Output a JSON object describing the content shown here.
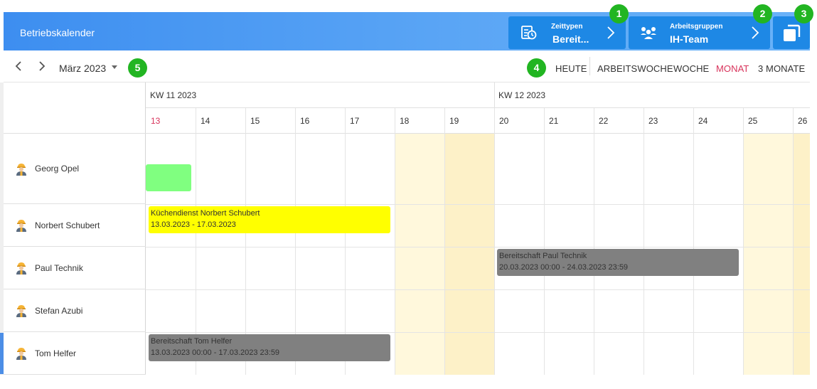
{
  "header": {
    "title": "Betriebskalender",
    "zeittypen": {
      "label": "Zeittypen",
      "value": "Bereit..."
    },
    "arbeitsgruppen": {
      "label": "Arbeitsgruppen",
      "value": "IH-Team"
    }
  },
  "badges": [
    "1",
    "2",
    "3",
    "4",
    "5"
  ],
  "toolbar": {
    "month": "März 2023",
    "views": {
      "heute": "HEUTE",
      "arbeitswoche": "ARBEITSWOCHE",
      "woche": "WOCHE",
      "monat": "MONAT",
      "drei_monate": "3 MONATE"
    },
    "active_view": "monat"
  },
  "calendar": {
    "weeks": [
      "KW 11 2023",
      "KW 12 2023"
    ],
    "days": [
      "13",
      "14",
      "15",
      "16",
      "17",
      "18",
      "19",
      "20",
      "21",
      "22",
      "23",
      "24",
      "25",
      "26"
    ],
    "today": "13"
  },
  "resources": [
    {
      "name": "Georg Opel"
    },
    {
      "name": "Norbert Schubert"
    },
    {
      "name": "Paul Technik"
    },
    {
      "name": "Stefan Azubi"
    },
    {
      "name": "Tom Helfer",
      "selected": true
    }
  ],
  "events": {
    "kuechendienst": {
      "title": "Küchendienst Norbert Schubert",
      "range": "13.03.2023 - 17.03.2023",
      "color": "#ffff00"
    },
    "bereitschaft_paul": {
      "title": "Bereitschaft Paul Technik",
      "range": "20.03.2023 00:00 - 24.03.2023 23:59",
      "color": "#808080"
    },
    "bereitschaft_tom": {
      "title": "Bereitschaft Tom Helfer",
      "range": "13.03.2023 00:00 - 17.03.2023 23:59",
      "color": "#808080"
    },
    "georg_block": {
      "color": "#80ff80"
    }
  },
  "colors": {
    "accent": "#1e88e5",
    "today": "#d8335b",
    "badge": "#22b522",
    "weekend": "#fff8dc"
  }
}
